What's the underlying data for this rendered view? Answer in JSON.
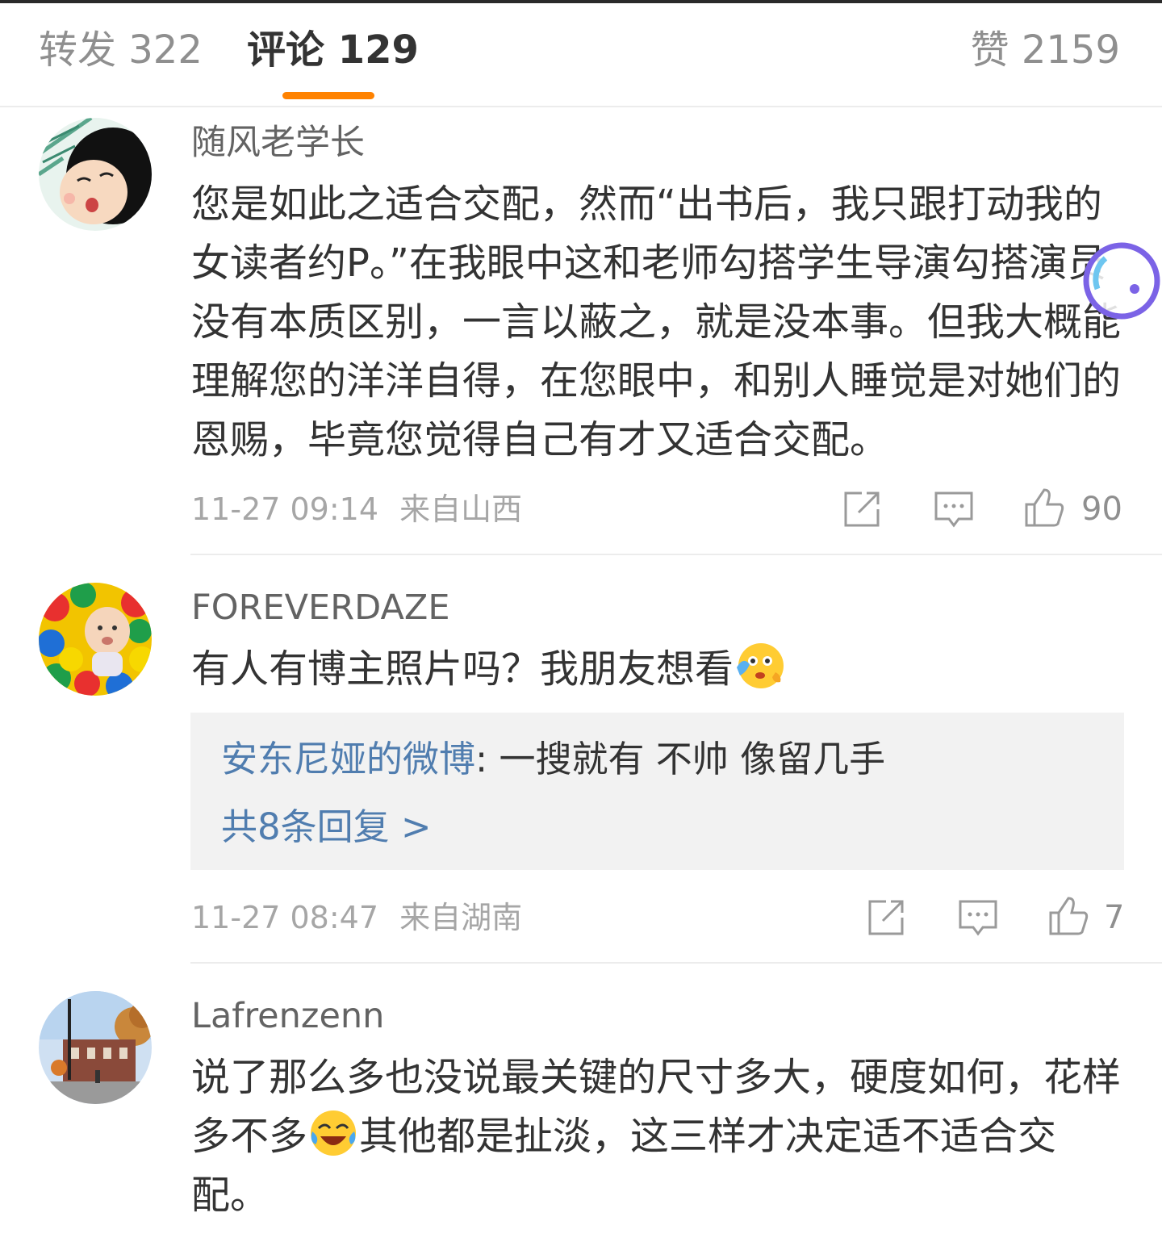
{
  "tabs": {
    "forward": "转发 322",
    "comments": "评论 129",
    "likes": "赞 2159"
  },
  "colors": {
    "accent": "#ff8200",
    "link": "#507daf",
    "muted": "#a6a6a6",
    "text": "#333333",
    "floating_button": "#7b63e6"
  },
  "comments": [
    {
      "username": "随风老学长",
      "avatar_icon": "cartoon-sleeping-child-avatar",
      "text": "您是如此之适合交配，然而“出书后，我只跟打动我的女读者约P。”在我眼中这和老师勾搭学生导演勾搭演员没有本质区别，一言以蔽之，就是没本事。但我大概能理解您的洋洋自得，在您眼中，和别人睡觉是对她们的恩赐，毕竟您觉得自己有才又适合交配。",
      "time": "11-27 09:14",
      "location": "来自山西",
      "likes": "90"
    },
    {
      "username": "FOREVERDAZE",
      "avatar_icon": "baby-in-ball-pit-avatar",
      "text": "有人有博主照片吗？我朋友想看",
      "emoji": "shy-emoji",
      "reply": {
        "author": "安东尼娅的微博",
        "text": ": 一搜就有 不帅 像留几手",
        "more": "共8条回复 >"
      },
      "time": "11-27 08:47",
      "location": "来自湖南",
      "likes": "7"
    },
    {
      "username": "Lafrenzenn",
      "avatar_icon": "street-scene-avatar",
      "text_before": "说了那么多也没说最关键的尺寸多大，硬度如何，花样多不多",
      "emoji": "laughing-crying-emoji",
      "text_after": "其他都是扯淡，这三样才决定适不适合交配。"
    }
  ]
}
